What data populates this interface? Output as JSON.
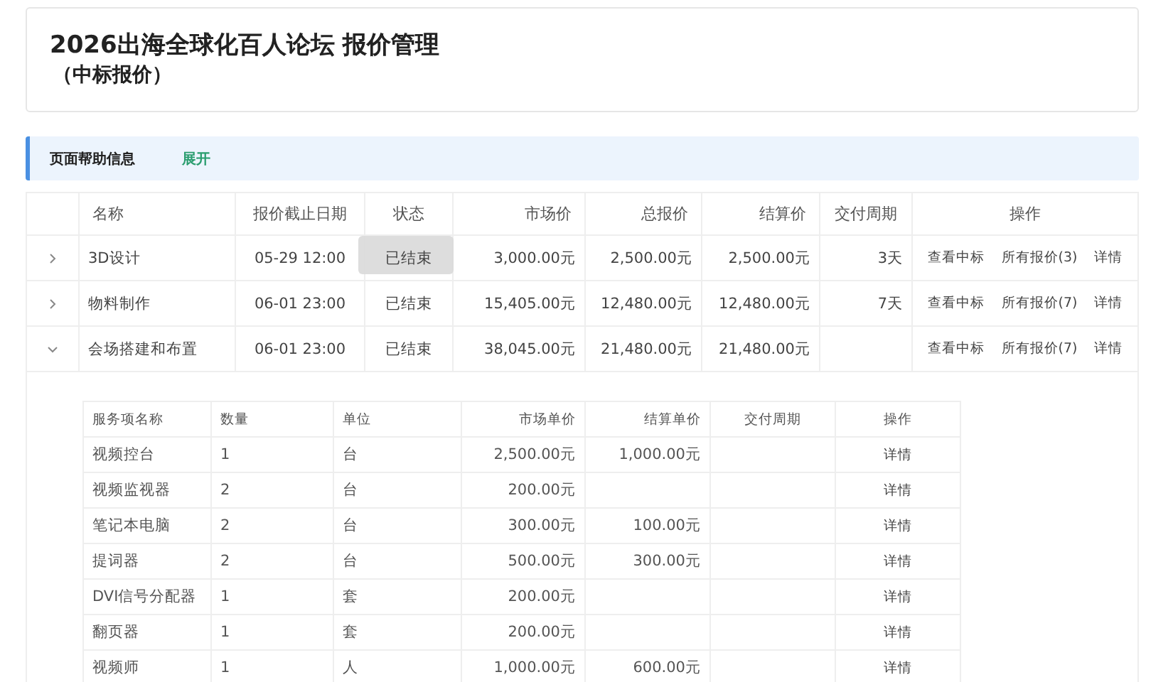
{
  "header": {
    "title": "2026出海全球化百人论坛 报价管理",
    "subtitle": "（中标报价）"
  },
  "help": {
    "label": "页面帮助信息",
    "toggle": "展开"
  },
  "table": {
    "columns": [
      "名称",
      "报价截止日期",
      "状态",
      "市场价",
      "总报价",
      "结算价",
      "交付周期",
      "操作"
    ],
    "rows": [
      {
        "expanded": false,
        "name": "3D设计",
        "deadline": "05-29 12:00",
        "status": "已结束",
        "tooltip": true,
        "market": "3,000.00元",
        "total": "2,500.00元",
        "settle": "2,500.00元",
        "period": "3天",
        "actions": [
          "查看中标",
          "所有报价(3)",
          "详情"
        ]
      },
      {
        "expanded": false,
        "name": "物料制作",
        "deadline": "06-01 23:00",
        "status": "已结束",
        "tooltip": false,
        "market": "15,405.00元",
        "total": "12,480.00元",
        "settle": "12,480.00元",
        "period": "7天",
        "actions": [
          "查看中标",
          "所有报价(7)",
          "详情"
        ]
      },
      {
        "expanded": true,
        "name": "会场搭建和布置",
        "deadline": "06-01 23:00",
        "status": "已结束",
        "tooltip": false,
        "market": "38,045.00元",
        "total": "21,480.00元",
        "settle": "21,480.00元",
        "period": "",
        "actions": [
          "查看中标",
          "所有报价(7)",
          "详情"
        ]
      }
    ]
  },
  "sub_table": {
    "columns": [
      "服务项名称",
      "数量",
      "单位",
      "市场单价",
      "结算单价",
      "交付周期",
      "操作"
    ],
    "rows": [
      {
        "name": "视频控台",
        "qty": "1",
        "unit": "台",
        "market": "2,500.00元",
        "settle": "1,000.00元",
        "action": "详情"
      },
      {
        "name": "视频监视器",
        "qty": "2",
        "unit": "台",
        "market": "200.00元",
        "settle": "",
        "action": "详情"
      },
      {
        "name": "笔记本电脑",
        "qty": "2",
        "unit": "台",
        "market": "300.00元",
        "settle": "100.00元",
        "action": "详情"
      },
      {
        "name": "提词器",
        "qty": "2",
        "unit": "台",
        "market": "500.00元",
        "settle": "300.00元",
        "action": "详情"
      },
      {
        "name": "DVI信号分配器",
        "qty": "1",
        "unit": "套",
        "market": "200.00元",
        "settle": "",
        "action": "详情"
      },
      {
        "name": "翻页器",
        "qty": "1",
        "unit": "套",
        "market": "200.00元",
        "settle": "",
        "action": "详情"
      },
      {
        "name": "视频师",
        "qty": "1",
        "unit": "人",
        "market": "1,000.00元",
        "settle": "600.00元",
        "action": "详情"
      }
    ]
  }
}
